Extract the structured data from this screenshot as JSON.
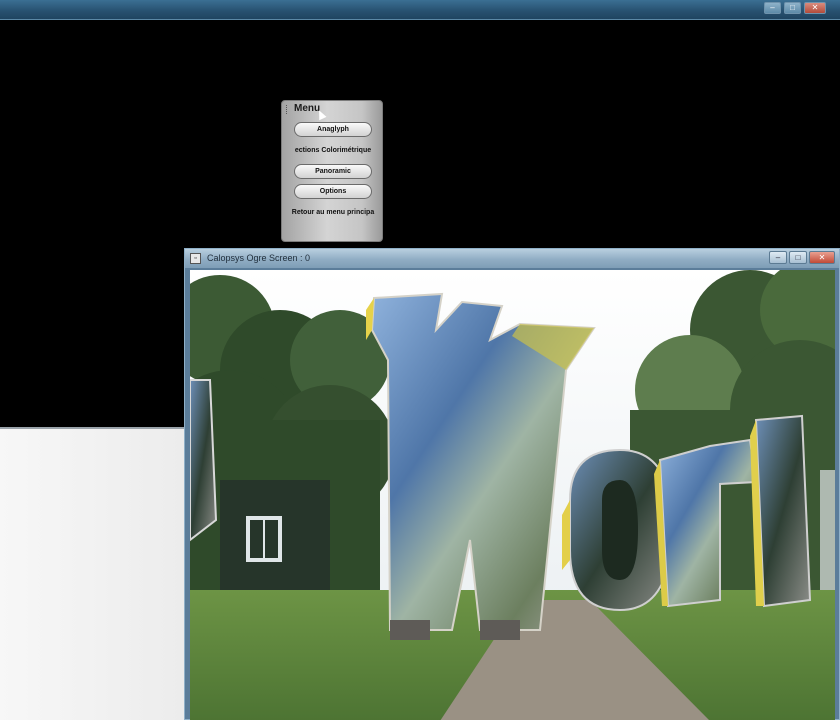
{
  "ogre_window": {
    "title": "Calopsys Ogre Screen : 0",
    "controls": {
      "minimize": "–",
      "maximize": "□",
      "close": "✕"
    }
  },
  "bg_window": {
    "controls": {
      "minimize": "–",
      "maximize": "□",
      "close": "✕"
    }
  },
  "menu": {
    "title": "Menu",
    "buttons": [
      {
        "label": "Anaglyph"
      },
      {
        "label": "ections Colorimétrique"
      },
      {
        "label": "Panoramic"
      },
      {
        "label": "Options"
      },
      {
        "label": "Retour au menu principa"
      }
    ]
  },
  "scene": {
    "text": "Worl",
    "sky_color": "#f2f5f6",
    "grass_color": "#5f8a3c",
    "tree_color": "#2f4a2a",
    "letter_color": "#7f9fc8"
  }
}
